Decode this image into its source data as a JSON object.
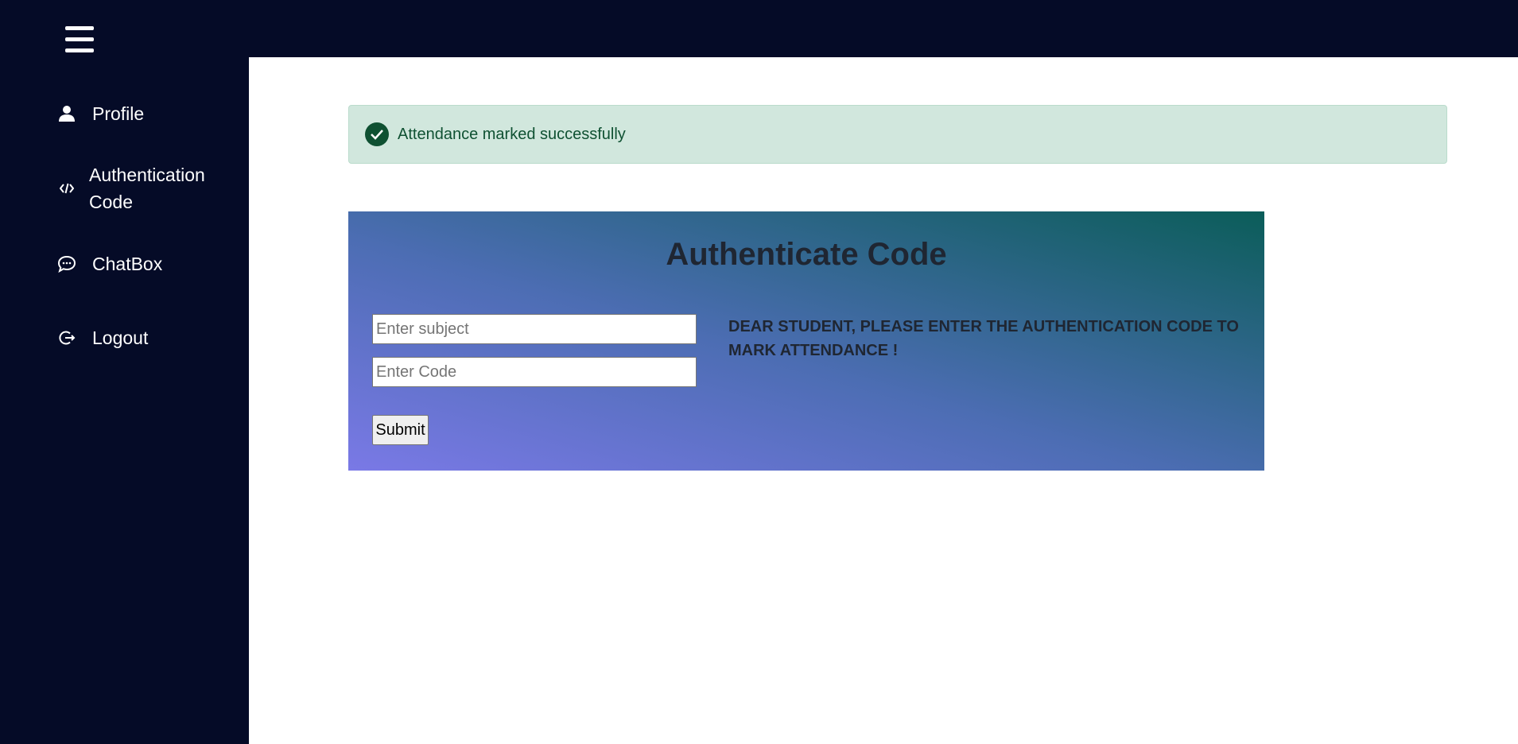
{
  "header": {
    "menu_icon": "hamburger-icon"
  },
  "sidebar": {
    "items": [
      {
        "label": "Profile",
        "icon": "user-icon"
      },
      {
        "label": "Authentication Code",
        "icon": "code-icon"
      },
      {
        "label": "ChatBox",
        "icon": "chat-icon"
      },
      {
        "label": "Logout",
        "icon": "logout-icon"
      }
    ]
  },
  "alert": {
    "message": "Attendance marked successfully",
    "icon": "check-circle-icon",
    "background_color": "#d1e7dd",
    "text_color": "#0f5132"
  },
  "auth_form": {
    "title": "Authenticate Code",
    "subject_placeholder": "Enter subject",
    "subject_value": "",
    "code_placeholder": "Enter Code",
    "code_value": "",
    "submit_label": "Submit",
    "message": "DEAR STUDENT, PLEASE ENTER THE AUTHENTICATION CODE TO MARK ATTENDANCE !"
  },
  "colors": {
    "sidebar_bg": "#050b27",
    "card_gradient": [
      "#7a79e6",
      "#4c6db3",
      "#0b5d59"
    ]
  }
}
